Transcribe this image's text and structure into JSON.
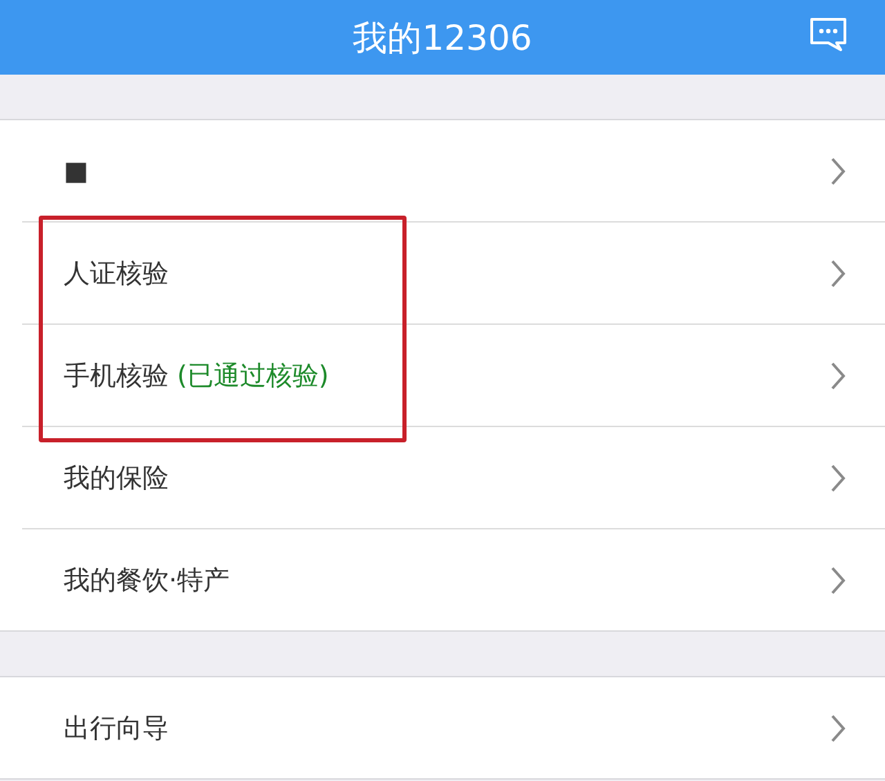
{
  "header": {
    "title": "我的12306"
  },
  "sections": [
    {
      "items": [
        {
          "label": "■",
          "highlighted": false
        },
        {
          "label": "人证核验",
          "highlighted": true
        },
        {
          "label": "手机核验",
          "status": "(已通过核验)",
          "highlighted": true
        },
        {
          "label": "我的保险",
          "highlighted": false
        },
        {
          "label": "我的餐饮·特产",
          "highlighted": false
        }
      ]
    },
    {
      "items": [
        {
          "label": "出行向导",
          "highlighted": false
        }
      ]
    }
  ]
}
